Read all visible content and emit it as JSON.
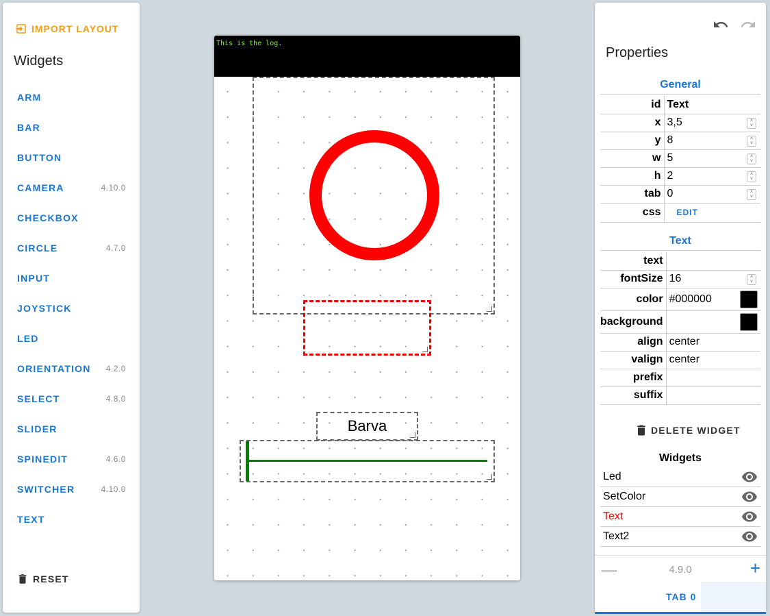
{
  "left_panel": {
    "import_label": "IMPORT LAYOUT",
    "title": "Widgets",
    "widgets": [
      {
        "label": "ARM",
        "version": ""
      },
      {
        "label": "BAR",
        "version": ""
      },
      {
        "label": "BUTTON",
        "version": ""
      },
      {
        "label": "CAMERA",
        "version": "4.10.0"
      },
      {
        "label": "CHECKBOX",
        "version": ""
      },
      {
        "label": "CIRCLE",
        "version": "4.7.0"
      },
      {
        "label": "INPUT",
        "version": ""
      },
      {
        "label": "JOYSTICK",
        "version": ""
      },
      {
        "label": "LED",
        "version": ""
      },
      {
        "label": "ORIENTATION",
        "version": "4.2.0"
      },
      {
        "label": "SELECT",
        "version": "4.8.0"
      },
      {
        "label": "SLIDER",
        "version": ""
      },
      {
        "label": "SPINEDIT",
        "version": "4.6.0"
      },
      {
        "label": "SWITCHER",
        "version": "4.10.0"
      },
      {
        "label": "TEXT",
        "version": ""
      }
    ],
    "reset_label": "RESET"
  },
  "canvas": {
    "log_text": "This is the log.",
    "text2_value": "Barva",
    "led_color": "#ff0000",
    "slider_color": "#008000"
  },
  "right_panel": {
    "title": "Properties",
    "general": {
      "heading": "General",
      "rows": [
        {
          "key": "id",
          "value": "Text"
        },
        {
          "key": "x",
          "value": "3,5"
        },
        {
          "key": "y",
          "value": "8"
        },
        {
          "key": "w",
          "value": "5"
        },
        {
          "key": "h",
          "value": "2"
        },
        {
          "key": "tab",
          "value": "0"
        },
        {
          "key": "css",
          "value": "EDIT"
        }
      ]
    },
    "text": {
      "heading": "Text",
      "rows": [
        {
          "key": "text",
          "value": ""
        },
        {
          "key": "fontSize",
          "value": "16"
        },
        {
          "key": "color",
          "value": "#000000"
        },
        {
          "key": "background",
          "value": ""
        },
        {
          "key": "align",
          "value": "center"
        },
        {
          "key": "valign",
          "value": "center"
        },
        {
          "key": "prefix",
          "value": ""
        },
        {
          "key": "suffix",
          "value": ""
        }
      ]
    },
    "delete_label": "DELETE WIDGET",
    "widgets_title": "Widgets",
    "widgets": [
      "Led",
      "SetColor",
      "Text",
      "Text2"
    ],
    "version": "4.9.0",
    "tab_label": "TAB 0"
  }
}
